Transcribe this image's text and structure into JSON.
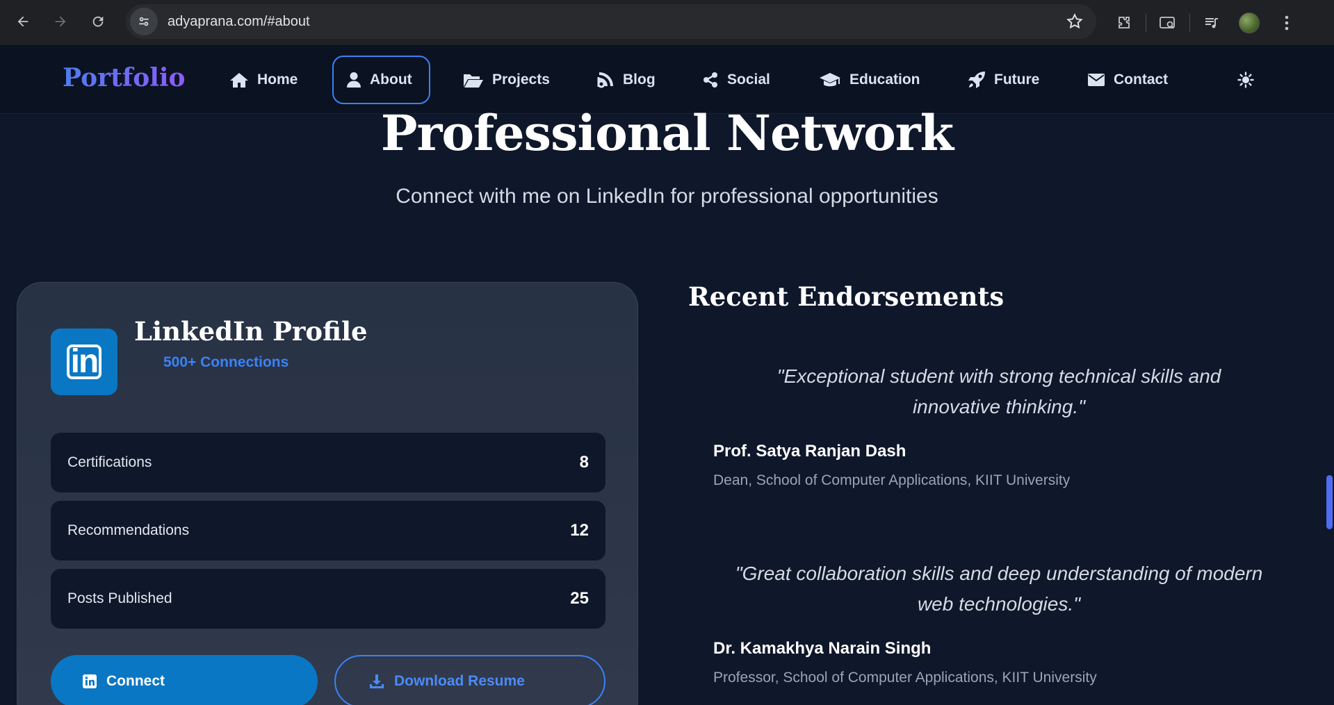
{
  "browser": {
    "url": "adyaprana.com/#about"
  },
  "site": {
    "brand": "Portfolio",
    "nav": [
      {
        "label": "Home",
        "icon": "home-icon"
      },
      {
        "label": "About",
        "icon": "user-icon"
      },
      {
        "label": "Projects",
        "icon": "folder-open-icon"
      },
      {
        "label": "Blog",
        "icon": "blog-icon"
      },
      {
        "label": "Social",
        "icon": "share-icon"
      },
      {
        "label": "Education",
        "icon": "graduation-cap-icon"
      },
      {
        "label": "Future",
        "icon": "rocket-icon"
      },
      {
        "label": "Contact",
        "icon": "envelope-icon"
      }
    ],
    "active_nav": "About"
  },
  "hero": {
    "title": "Professional Network",
    "subtitle": "Connect with me on LinkedIn for professional opportunities"
  },
  "linkedin": {
    "logo_text": "in",
    "title": "LinkedIn Profile",
    "connections": "500+ Connections",
    "stats": [
      {
        "label": "Certifications",
        "value": "8"
      },
      {
        "label": "Recommendations",
        "value": "12"
      },
      {
        "label": "Posts Published",
        "value": "25"
      }
    ],
    "connect_label": "Connect",
    "resume_label": "Download Resume"
  },
  "endorsements": {
    "title": "Recent Endorsements",
    "items": [
      {
        "quote": "\"Exceptional student with strong technical skills and innovative thinking.\"",
        "name": "Prof. Satya Ranjan Dash",
        "role": "Dean, School of Computer Applications, KIIT University"
      },
      {
        "quote": "\"Great collaboration skills and deep understanding of modern web technologies.\"",
        "name": "Dr. Kamakhya Narain Singh",
        "role": "Professor, School of Computer Applications, KIIT University"
      }
    ]
  },
  "colors": {
    "accent": "#3b82f6",
    "linkedin": "#0a77c4",
    "background": "#0f172a"
  }
}
